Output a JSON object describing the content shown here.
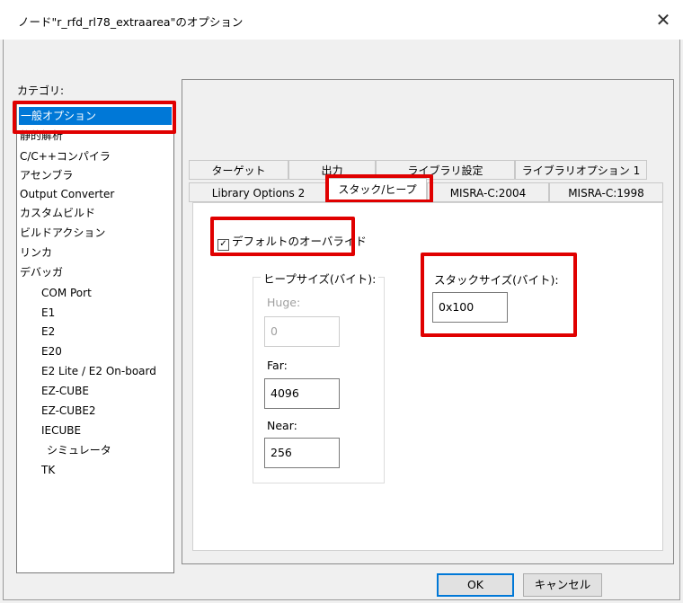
{
  "window": {
    "title": "ノード\"r_rfd_rl78_extraarea\"のオプション",
    "close_glyph": "✕"
  },
  "category": {
    "label": "カテゴリ:",
    "items": [
      {
        "label": "一般オプション"
      },
      {
        "label": "静的解析"
      },
      {
        "label": "C/C++コンパイラ"
      },
      {
        "label": "アセンブラ"
      },
      {
        "label": "Output Converter"
      },
      {
        "label": "カスタムビルド"
      },
      {
        "label": "ビルドアクション"
      },
      {
        "label": "リンカ"
      },
      {
        "label": "デバッガ"
      },
      {
        "label": "COM Port"
      },
      {
        "label": "E1"
      },
      {
        "label": "E2"
      },
      {
        "label": "E20"
      },
      {
        "label": "E2 Lite / E2 On-board"
      },
      {
        "label": "EZ-CUBE"
      },
      {
        "label": "EZ-CUBE2"
      },
      {
        "label": "IECUBE"
      },
      {
        "label": "シミュレータ"
      },
      {
        "label": "TK"
      }
    ],
    "selected": "一般オプション"
  },
  "tabs": {
    "row1": [
      "ターゲット",
      "出力",
      "ライブラリ設定",
      "ライブラリオプション 1"
    ],
    "row2": [
      "Library Options 2",
      "スタック/ヒープ",
      "MISRA-C:2004",
      "MISRA-C:1998"
    ],
    "active": "スタック/ヒープ"
  },
  "override": {
    "label": "デフォルトのオーバライド",
    "checked": true,
    "check_glyph": "✓"
  },
  "heap": {
    "title": "ヒープサイズ(バイト):",
    "huge_label": "Huge:",
    "huge_value": "0",
    "far_label": "Far:",
    "far_value": "4096",
    "near_label": "Near:",
    "near_value": "256"
  },
  "stack": {
    "title": "スタックサイズ(バイト):",
    "value": "0x100"
  },
  "buttons": {
    "ok": "OK",
    "cancel": "キャンセル"
  },
  "colors": {
    "highlight": "#e00000",
    "selection": "#0078d7"
  }
}
